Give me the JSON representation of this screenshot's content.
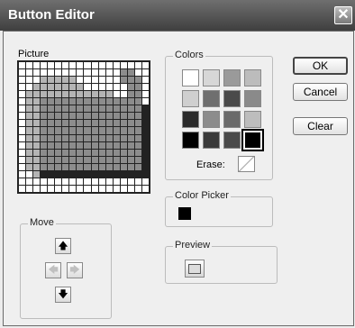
{
  "window": {
    "title": "Button Editor",
    "close_glyph": "✕"
  },
  "picture": {
    "label": "Picture",
    "rows": [
      "000000000000000000",
      "000000000000002200",
      "000111110000002220",
      "001111111000000220",
      "011111111111100220",
      "011222222222222220",
      "011222222222222223",
      "011222222222222223",
      "011222222222222223",
      "011222222222222223",
      "011222222222222223",
      "011222222222222223",
      "011222222222222223",
      "011222222222222223",
      "011222222222222223",
      "001333333333333333",
      "000000000000000000",
      "000000000000000000"
    ],
    "palette_map": {
      "0": "#ffffff",
      "1": "#b4b4b4",
      "2": "#8c8c8c",
      "3": "#222222"
    }
  },
  "colors": {
    "label": "Colors",
    "swatches": [
      "#ffffff",
      "#d7d7d7",
      "#9a9a9a",
      "#bcbcbc",
      "#cfcfcf",
      "#6f6f6f",
      "#4a4a4a",
      "#8a8a8a",
      "#2a2a2a",
      "#8c8c8c",
      "#6a6a6a",
      "#bdbdbd",
      "#000000",
      "#3a3a3a",
      "#4a4a4a",
      "#000000"
    ],
    "erase_label": "Erase:"
  },
  "color_picker": {
    "label": "Color Picker",
    "value_color": "#000000"
  },
  "move": {
    "label": "Move",
    "up": "🡅",
    "down": "🡇",
    "left": "🡄",
    "right": "🡆"
  },
  "preview": {
    "label": "Preview"
  },
  "buttons": {
    "ok": "OK",
    "cancel": "Cancel",
    "clear": "Clear"
  }
}
